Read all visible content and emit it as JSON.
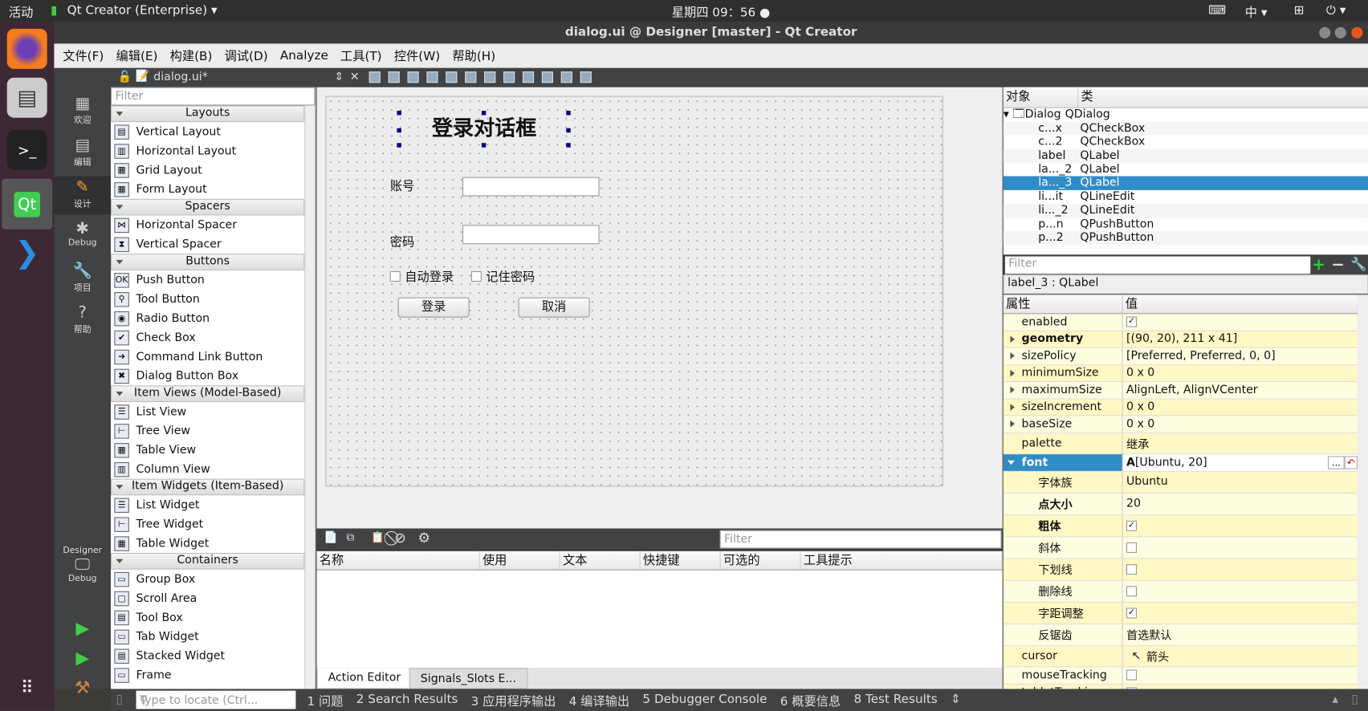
{
  "topbar": {
    "activities": "活动",
    "app_name": "Qt Creator (Enterprise) ▾",
    "clock": "星期四 09：56 ●",
    "ime": "中 ▾"
  },
  "window": {
    "title": "dialog.ui @ Designer [master] - Qt Creator"
  },
  "menu": [
    "文件(F)",
    "编辑(E)",
    "构建(B)",
    "调试(D)",
    "Analyze",
    "工具(T)",
    "控件(W)",
    "帮助(H)"
  ],
  "modes": [
    {
      "label": "欢迎",
      "icon": "grid-icon"
    },
    {
      "label": "编辑",
      "icon": "edit-icon"
    },
    {
      "label": "设计",
      "icon": "pen-icon"
    },
    {
      "label": "Debug",
      "icon": "bug-icon"
    },
    {
      "label": "项目",
      "icon": "wrench-icon"
    },
    {
      "label": "帮助",
      "icon": "help-icon"
    }
  ],
  "mode_kit": {
    "title": "Designer",
    "label": "Debug"
  },
  "editor_tab": {
    "file": "dialog.ui*",
    "close": "✕"
  },
  "widgetbox": {
    "filter_placeholder": "Filter",
    "categories": [
      {
        "name": "Layouts",
        "items": [
          "Vertical Layout",
          "Horizontal Layout",
          "Grid Layout",
          "Form Layout"
        ]
      },
      {
        "name": "Spacers",
        "items": [
          "Horizontal Spacer",
          "Vertical Spacer"
        ]
      },
      {
        "name": "Buttons",
        "items": [
          "Push Button",
          "Tool Button",
          "Radio Button",
          "Check Box",
          "Command Link Button",
          "Dialog Button Box"
        ]
      },
      {
        "name": "Item Views (Model-Based)",
        "items": [
          "List View",
          "Tree View",
          "Table View",
          "Column View"
        ]
      },
      {
        "name": "Item Widgets (Item-Based)",
        "items": [
          "List Widget",
          "Tree Widget",
          "Table Widget"
        ]
      },
      {
        "name": "Containers",
        "items": [
          "Group Box",
          "Scroll Area",
          "Tool Box",
          "Tab Widget",
          "Stacked Widget",
          "Frame"
        ]
      }
    ]
  },
  "form": {
    "title": "登录对话框",
    "account_label": "账号",
    "password_label": "密码",
    "auto_login": "自动登录",
    "remember": "记住密码",
    "login_button": "登录",
    "cancel_button": "取消",
    "account_value": "",
    "password_value": ""
  },
  "action_editor": {
    "filter_placeholder": "Filter",
    "columns": [
      "名称",
      "使用",
      "文本",
      "快捷键",
      "可选的",
      "工具提示"
    ],
    "tabs": [
      "Action Editor",
      "Signals_Slots E..."
    ]
  },
  "object_inspector": {
    "columns": [
      "对象",
      "类"
    ],
    "rows": [
      {
        "object": "Dialog",
        "class": "QDialog"
      },
      {
        "object": "c...x",
        "class": "QCheckBox"
      },
      {
        "object": "c...2",
        "class": "QCheckBox"
      },
      {
        "object": "label",
        "class": "QLabel"
      },
      {
        "object": "la..._2",
        "class": "QLabel"
      },
      {
        "object": "la..._3",
        "class": "QLabel",
        "selected": true
      },
      {
        "object": "li...it",
        "class": "QLineEdit"
      },
      {
        "object": "li..._2",
        "class": "QLineEdit"
      },
      {
        "object": "p...n",
        "class": "QPushButton"
      },
      {
        "object": "p...2",
        "class": "QPushButton"
      }
    ]
  },
  "property_editor": {
    "filter_placeholder": "Filter",
    "current": "label_3 : QLabel",
    "columns": [
      "属性",
      "值"
    ],
    "rows": [
      {
        "name": "enabled",
        "value": "",
        "check": true
      },
      {
        "name": "geometry",
        "value": "[(90, 20), 211 x 41]",
        "bold": true,
        "expandable": true
      },
      {
        "name": "sizePolicy",
        "value": "[Preferred, Preferred, 0, 0]",
        "expandable": true
      },
      {
        "name": "minimumSize",
        "value": "0 x 0",
        "expandable": true
      },
      {
        "name": "maximumSize",
        "value": "AlignLeft, AlignVCenter",
        "expandable": true
      },
      {
        "name": "sizeIncrement",
        "value": "0 x 0",
        "expandable": true
      },
      {
        "name": "baseSize",
        "value": "0 x 0",
        "expandable": true
      },
      {
        "name": "palette",
        "value": "继承"
      },
      {
        "name": "font",
        "value": "[Ubuntu, 20]",
        "selected": true
      },
      {
        "name": "字体族",
        "value": "Ubuntu",
        "sub": true
      },
      {
        "name": "点大小",
        "value": "20",
        "sub": true,
        "bold": true
      },
      {
        "name": "粗体",
        "value": "",
        "check": true,
        "sub": true,
        "bold": true
      },
      {
        "name": "斜体",
        "value": "",
        "check": false,
        "sub": true
      },
      {
        "name": "下划线",
        "value": "",
        "check": false,
        "sub": true
      },
      {
        "name": "删除线",
        "value": "",
        "check": false,
        "sub": true
      },
      {
        "name": "字距调整",
        "value": "",
        "check": true,
        "sub": true
      },
      {
        "name": "反锯齿",
        "value": "首选默认",
        "sub": true
      },
      {
        "name": "cursor",
        "value": "箭头"
      },
      {
        "name": "mouseTracking",
        "value": "",
        "check": false
      },
      {
        "name": "tabletTracking",
        "value": "",
        "check": false
      }
    ]
  },
  "statusbar": {
    "locate_placeholder": "Type to locate (Ctrl...",
    "panes": [
      "1 问题",
      "2 Search Results",
      "3 应用程序输出",
      "4 编译输出",
      "5 Debugger Console",
      "6 概要信息",
      "8 Test Results"
    ]
  },
  "colors": {
    "selection": "#308cc6",
    "property_bg": "#fffde0",
    "dark_panel": "#404244"
  }
}
